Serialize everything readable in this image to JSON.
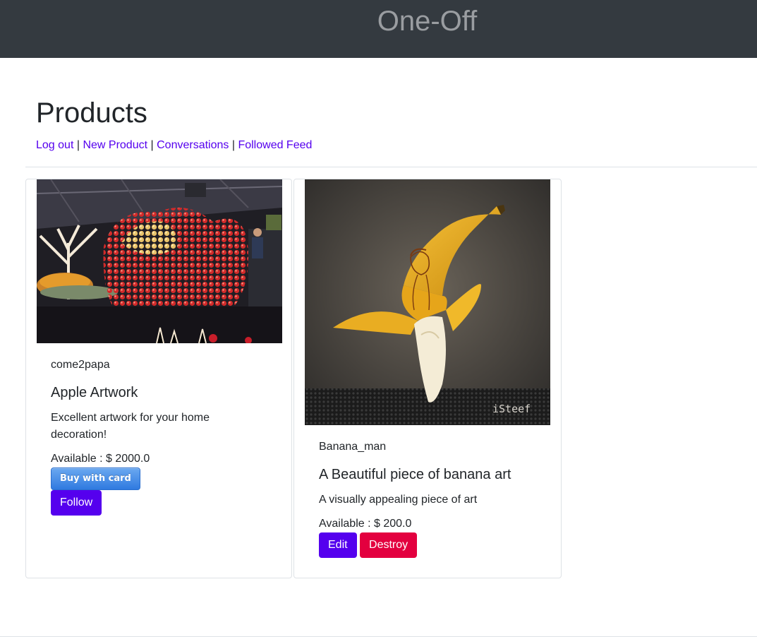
{
  "header": {
    "brand": "One-Off"
  },
  "page": {
    "title": "Products",
    "nav": [
      {
        "label": "Log out"
      },
      {
        "label": "New Product"
      },
      {
        "label": "Conversations"
      },
      {
        "label": "Followed Feed"
      }
    ],
    "nav_separator": "|"
  },
  "products": [
    {
      "seller": "come2papa",
      "title": "Apple Artwork",
      "description": "Excellent artwork for your home decoration!",
      "availability": "Available : $ 2000.0",
      "image_icon": "apple-artwork-photo",
      "buttons": {
        "buy": "Buy with card",
        "follow": "Follow"
      }
    },
    {
      "seller": "Banana_man",
      "title": "A Beautiful piece of banana art",
      "description": "A visually appealing piece of art",
      "availability": "Available : $ 200.0",
      "image_icon": "banana-art-photo",
      "image_watermark": "iSteef",
      "buttons": {
        "edit": "Edit",
        "destroy": "Destroy"
      }
    }
  ],
  "colors": {
    "navbar": "#343a40",
    "link": "#5500ee",
    "primary": "#5500ee",
    "danger": "#e3003f"
  }
}
